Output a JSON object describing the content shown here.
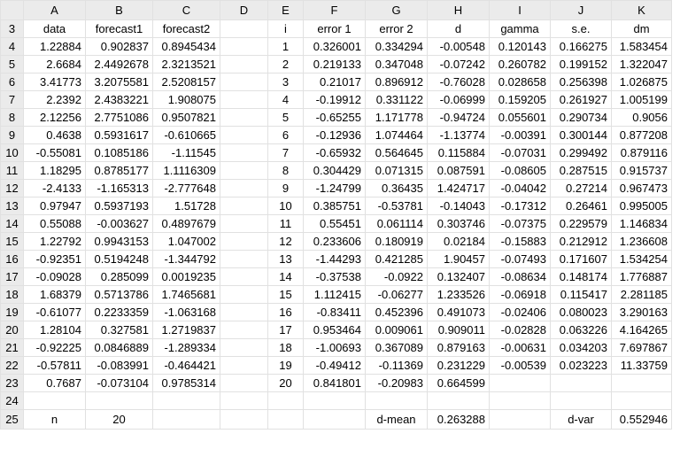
{
  "columns": [
    "A",
    "B",
    "C",
    "D",
    "E",
    "F",
    "G",
    "H",
    "I",
    "J",
    "K"
  ],
  "row_numbers": [
    3,
    4,
    5,
    6,
    7,
    8,
    9,
    10,
    11,
    12,
    13,
    14,
    15,
    16,
    17,
    18,
    19,
    20,
    21,
    22,
    23,
    24,
    25
  ],
  "headers": {
    "A": "data",
    "B": "forecast1",
    "C": "forecast2",
    "E": "i",
    "F": "error 1",
    "G": "error 2",
    "H": "d",
    "I": "gamma",
    "J": "s.e.",
    "K": "dm"
  },
  "rows": [
    [
      "1.22884",
      "0.902837",
      "0.8945434",
      "",
      "1",
      "0.326001",
      "0.334294",
      "-0.00548",
      "0.120143",
      "0.166275",
      "1.583454"
    ],
    [
      "2.6684",
      "2.4492678",
      "2.3213521",
      "",
      "2",
      "0.219133",
      "0.347048",
      "-0.07242",
      "0.260782",
      "0.199152",
      "1.322047"
    ],
    [
      "3.41773",
      "3.2075581",
      "2.5208157",
      "",
      "3",
      "0.21017",
      "0.896912",
      "-0.76028",
      "0.028658",
      "0.256398",
      "1.026875"
    ],
    [
      "2.2392",
      "2.4383221",
      "1.908075",
      "",
      "4",
      "-0.19912",
      "0.331122",
      "-0.06999",
      "0.159205",
      "0.261927",
      "1.005199"
    ],
    [
      "2.12256",
      "2.7751086",
      "0.9507821",
      "",
      "5",
      "-0.65255",
      "1.171778",
      "-0.94724",
      "0.055601",
      "0.290734",
      "0.9056"
    ],
    [
      "0.4638",
      "0.5931617",
      "-0.610665",
      "",
      "6",
      "-0.12936",
      "1.074464",
      "-1.13774",
      "-0.00391",
      "0.300144",
      "0.877208"
    ],
    [
      "-0.55081",
      "0.1085186",
      "-1.11545",
      "",
      "7",
      "-0.65932",
      "0.564645",
      "0.115884",
      "-0.07031",
      "0.299492",
      "0.879116"
    ],
    [
      "1.18295",
      "0.8785177",
      "1.1116309",
      "",
      "8",
      "0.304429",
      "0.071315",
      "0.087591",
      "-0.08605",
      "0.287515",
      "0.915737"
    ],
    [
      "-2.4133",
      "-1.165313",
      "-2.777648",
      "",
      "9",
      "-1.24799",
      "0.36435",
      "1.424717",
      "-0.04042",
      "0.27214",
      "0.967473"
    ],
    [
      "0.97947",
      "0.5937193",
      "1.51728",
      "",
      "10",
      "0.385751",
      "-0.53781",
      "-0.14043",
      "-0.17312",
      "0.26461",
      "0.995005"
    ],
    [
      "0.55088",
      "-0.003627",
      "0.4897679",
      "",
      "11",
      "0.55451",
      "0.061114",
      "0.303746",
      "-0.07375",
      "0.229579",
      "1.146834"
    ],
    [
      "1.22792",
      "0.9943153",
      "1.047002",
      "",
      "12",
      "0.233606",
      "0.180919",
      "0.02184",
      "-0.15883",
      "0.212912",
      "1.236608"
    ],
    [
      "-0.92351",
      "0.5194248",
      "-1.344792",
      "",
      "13",
      "-1.44293",
      "0.421285",
      "1.90457",
      "-0.07493",
      "0.171607",
      "1.534254"
    ],
    [
      "-0.09028",
      "0.285099",
      "0.0019235",
      "",
      "14",
      "-0.37538",
      "-0.0922",
      "0.132407",
      "-0.08634",
      "0.148174",
      "1.776887"
    ],
    [
      "1.68379",
      "0.5713786",
      "1.7465681",
      "",
      "15",
      "1.112415",
      "-0.06277",
      "1.233526",
      "-0.06918",
      "0.115417",
      "2.281185"
    ],
    [
      "-0.61077",
      "0.2233359",
      "-1.063168",
      "",
      "16",
      "-0.83411",
      "0.452396",
      "0.491073",
      "-0.02406",
      "0.080023",
      "3.290163"
    ],
    [
      "1.28104",
      "0.327581",
      "1.2719837",
      "",
      "17",
      "0.953464",
      "0.009061",
      "0.909011",
      "-0.02828",
      "0.063226",
      "4.164265"
    ],
    [
      "-0.92225",
      "0.0846889",
      "-1.289334",
      "",
      "18",
      "-1.00693",
      "0.367089",
      "0.879163",
      "-0.00631",
      "0.034203",
      "7.697867"
    ],
    [
      "-0.57811",
      "-0.083991",
      "-0.464421",
      "",
      "19",
      "-0.49412",
      "-0.11369",
      "0.231229",
      "-0.00539",
      "0.023223",
      "11.33759"
    ],
    [
      "0.7687",
      "-0.073104",
      "0.9785314",
      "",
      "20",
      "0.841801",
      "-0.20983",
      "0.664599",
      "",
      "",
      ""
    ]
  ],
  "summary": {
    "n_label": "n",
    "n_value": "20",
    "dmean_label": "d-mean",
    "dmean_value": "0.263288",
    "dvar_label": "d-var",
    "dvar_value": "0.552946"
  }
}
